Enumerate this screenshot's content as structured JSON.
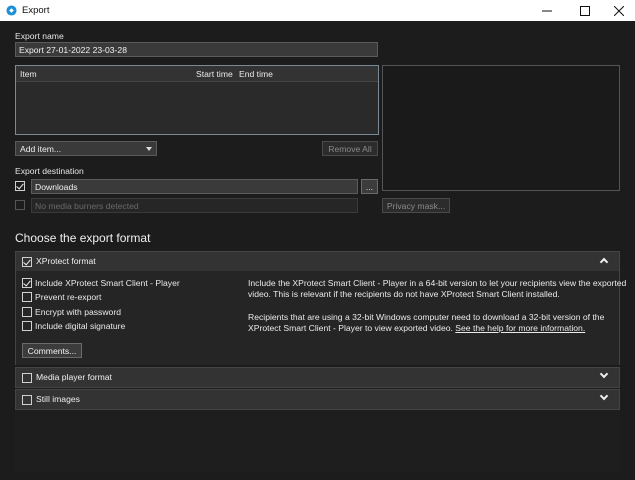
{
  "window": {
    "title": "Export",
    "icon": "xprotect-icon",
    "controls": [
      "minimize-icon",
      "maximize-icon",
      "close-icon"
    ]
  },
  "export_name": {
    "label": "Export name",
    "value": "Export 27-01-2022 23-03-28"
  },
  "item_list": {
    "columns": [
      "Item",
      "Start time",
      "End time"
    ],
    "rows": []
  },
  "add_item": {
    "label": "Add item...",
    "icon": "chevron-down-icon"
  },
  "remove_all": {
    "label": "Remove All",
    "enabled": false
  },
  "destination": {
    "label": "Export destination",
    "checked": true,
    "path_value": "Downloads",
    "browse_label": "...",
    "media_burner_placeholder": "No media burners detected",
    "media_burner_checked": false
  },
  "privacy_mask": {
    "label": "Privacy mask...",
    "enabled": false
  },
  "format_heading": "Choose the export format",
  "formats": {
    "xprotect": {
      "label": "XProtect format",
      "checked": true,
      "expanded": true,
      "options": [
        {
          "label": "Include XProtect Smart Client - Player",
          "checked": true
        },
        {
          "label": "Prevent re-export",
          "checked": false
        },
        {
          "label": "Encrypt with password",
          "checked": false
        },
        {
          "label": "Include digital signature",
          "checked": false
        }
      ],
      "comments_label": "Comments...",
      "desc_p1_line1": "Include the XProtect Smart Client - Player in a 64-bit version to let your recipients view the exported",
      "desc_p1_line2": "video. This is relevant if the recipients do not have XProtect Smart Client installed.",
      "desc_p2_line1": "Recipients that are using a 32-bit Windows computer need to download a 32-bit version of the",
      "desc_p2_line2_prefix": "XProtect Smart Client - Player to view exported video.",
      "desc_p2_link": "See the help for more information."
    },
    "media_player": {
      "label": "Media player format",
      "checked": false,
      "expanded": false
    },
    "still_images": {
      "label": "Still images",
      "checked": false,
      "expanded": false
    }
  },
  "colors": {
    "background": "#1c1c1c",
    "panel": "#333333",
    "accent": "#1e90d6",
    "text": "#e6e6e6"
  }
}
